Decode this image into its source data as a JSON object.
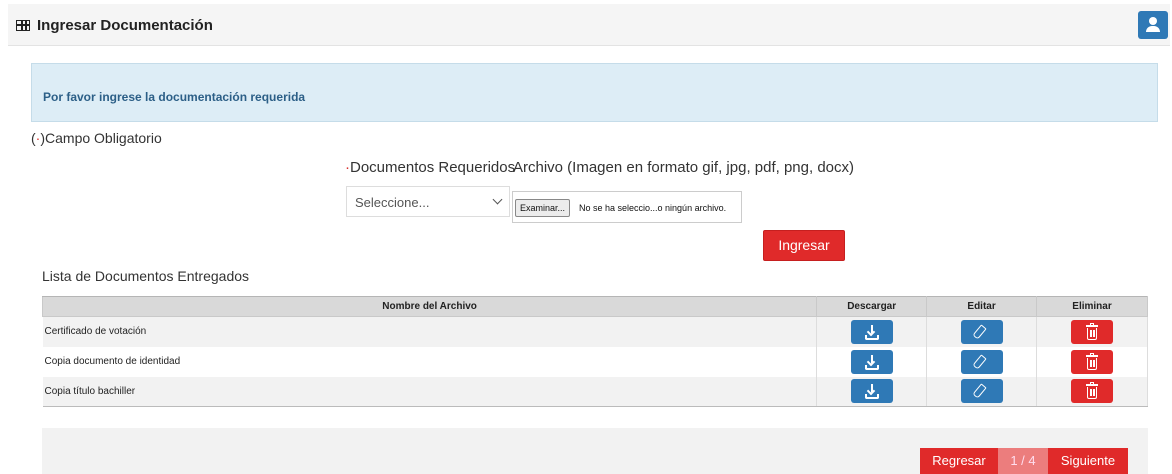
{
  "header": {
    "title": "Ingresar Documentación",
    "icon": "table-grid-icon",
    "user_icon": "user-icon"
  },
  "alert": {
    "message": "Por favor ingrese la documentación requerida"
  },
  "required_note": {
    "marker": "(·)",
    "label": "Campo Obligatorio"
  },
  "form": {
    "doc_label_marker": "·",
    "doc_label": "Documentos Requeridos",
    "file_label": "Archivo (Imagen en formato gif, jpg, pdf, png, docx)",
    "select_value": "Seleccione...",
    "file_button": "Examinar...",
    "file_status": "No se ha seleccio...o ningún archivo.",
    "submit": "Ingresar"
  },
  "list": {
    "title": "Lista de Documentos Entregados",
    "columns": [
      "Nombre del Archivo",
      "Descargar",
      "Editar",
      "Eliminar"
    ],
    "rows": [
      {
        "name": "Certificado de votación"
      },
      {
        "name": "Copia documento de identidad"
      },
      {
        "name": "Copia título bachiller"
      }
    ]
  },
  "pager": {
    "prev": "Regresar",
    "page": "1 / 4",
    "next": "Siguiente"
  },
  "colors": {
    "primary_blue": "#2f79b6",
    "danger_red": "#e02a2a",
    "alert_bg": "#ddedf6"
  }
}
